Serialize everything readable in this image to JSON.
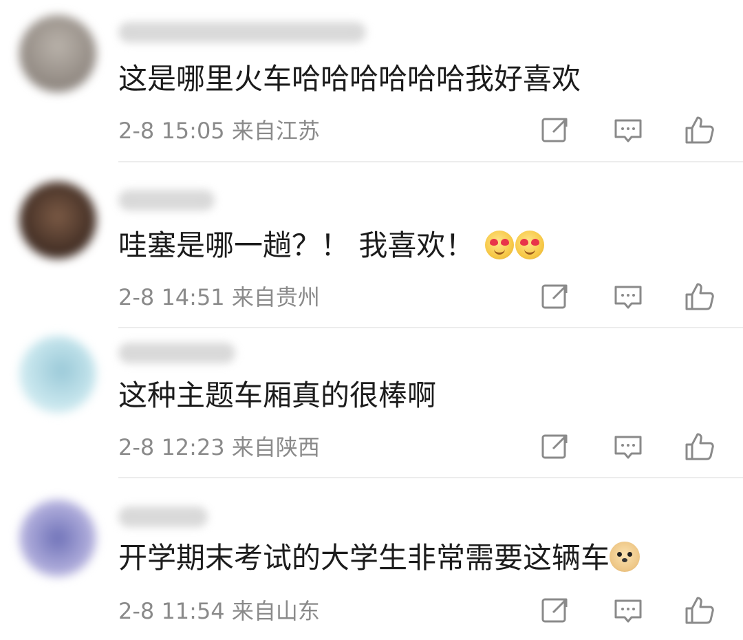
{
  "colors": {
    "text": "#1c1c1c",
    "meta": "#8a8a8a",
    "icon": "#8a8a8a",
    "divider": "#ececec"
  },
  "comments": [
    {
      "text": "这是哪里火车哈哈哈哈哈哈我好喜欢",
      "time": "2-8 15:05",
      "location": "来自江苏",
      "emojis": []
    },
    {
      "text": "哇塞是哪一趟？！ 我喜欢！",
      "time": "2-8 14:51",
      "location": "来自贵州",
      "emojis": [
        "heart-eyes",
        "heart-eyes"
      ]
    },
    {
      "text": "这种主题车厢真的很棒啊",
      "time": "2-8 12:23",
      "location": "来自陕西",
      "emojis": []
    },
    {
      "text": "开学期末考试的大学生非常需要这辆车",
      "time": "2-8 11:54",
      "location": "来自山东",
      "emojis": [
        "doge"
      ]
    }
  ],
  "icons": [
    "share-icon",
    "comment-icon",
    "like-icon"
  ]
}
